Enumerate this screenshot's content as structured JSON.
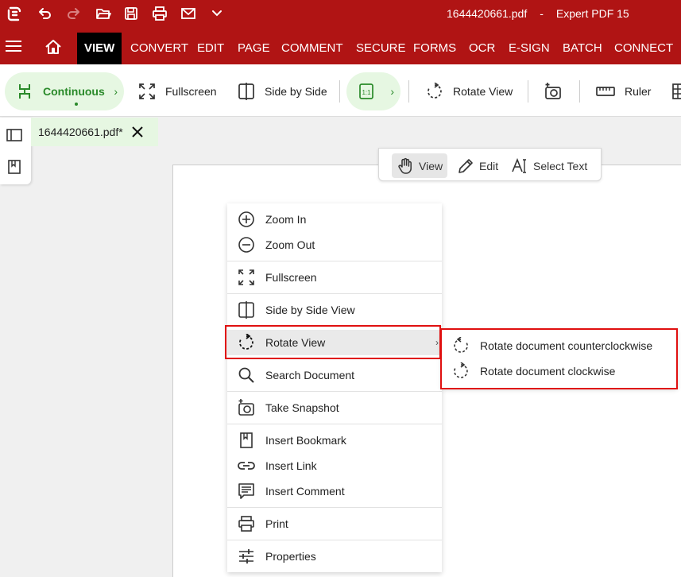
{
  "window": {
    "file_name": "1644420661.pdf",
    "separator": "-",
    "app_name": "Expert PDF 15"
  },
  "menubar": {
    "tabs": [
      {
        "label": "VIEW",
        "active": true
      },
      {
        "label": "CONVERT"
      },
      {
        "label": "EDIT"
      },
      {
        "label": "PAGE"
      },
      {
        "label": "COMMENT"
      },
      {
        "label": "SECURE"
      },
      {
        "label": "FORMS"
      },
      {
        "label": "OCR"
      },
      {
        "label": "E-SIGN"
      },
      {
        "label": "BATCH"
      },
      {
        "label": "CONNECT"
      }
    ]
  },
  "toolbar": {
    "continuous": "Continuous",
    "fullscreen": "Fullscreen",
    "side_by_side": "Side by Side",
    "zoom_actual": "1:1",
    "rotate_view": "Rotate View",
    "ruler": "Ruler",
    "chevron": "›"
  },
  "doc_tab": {
    "label": "1644420661.pdf*"
  },
  "modebar": {
    "view": "View",
    "edit": "Edit",
    "select_text": "Select Text"
  },
  "context_menu": {
    "zoom_in": "Zoom In",
    "zoom_out": "Zoom Out",
    "fullscreen": "Fullscreen",
    "side_by_side_view": "Side by Side View",
    "rotate_view": "Rotate View",
    "search_document": "Search Document",
    "take_snapshot": "Take Snapshot",
    "insert_bookmark": "Insert Bookmark",
    "insert_link": "Insert Link",
    "insert_comment": "Insert Comment",
    "print": "Print",
    "properties": "Properties",
    "submenu_arrow": "›"
  },
  "submenu": {
    "ccw": "Rotate document counterclockwise",
    "cw": "Rotate document clockwise"
  },
  "colors": {
    "brand_red": "#b01414",
    "accent_green": "#2a8a2a",
    "highlight": "#e01010"
  }
}
